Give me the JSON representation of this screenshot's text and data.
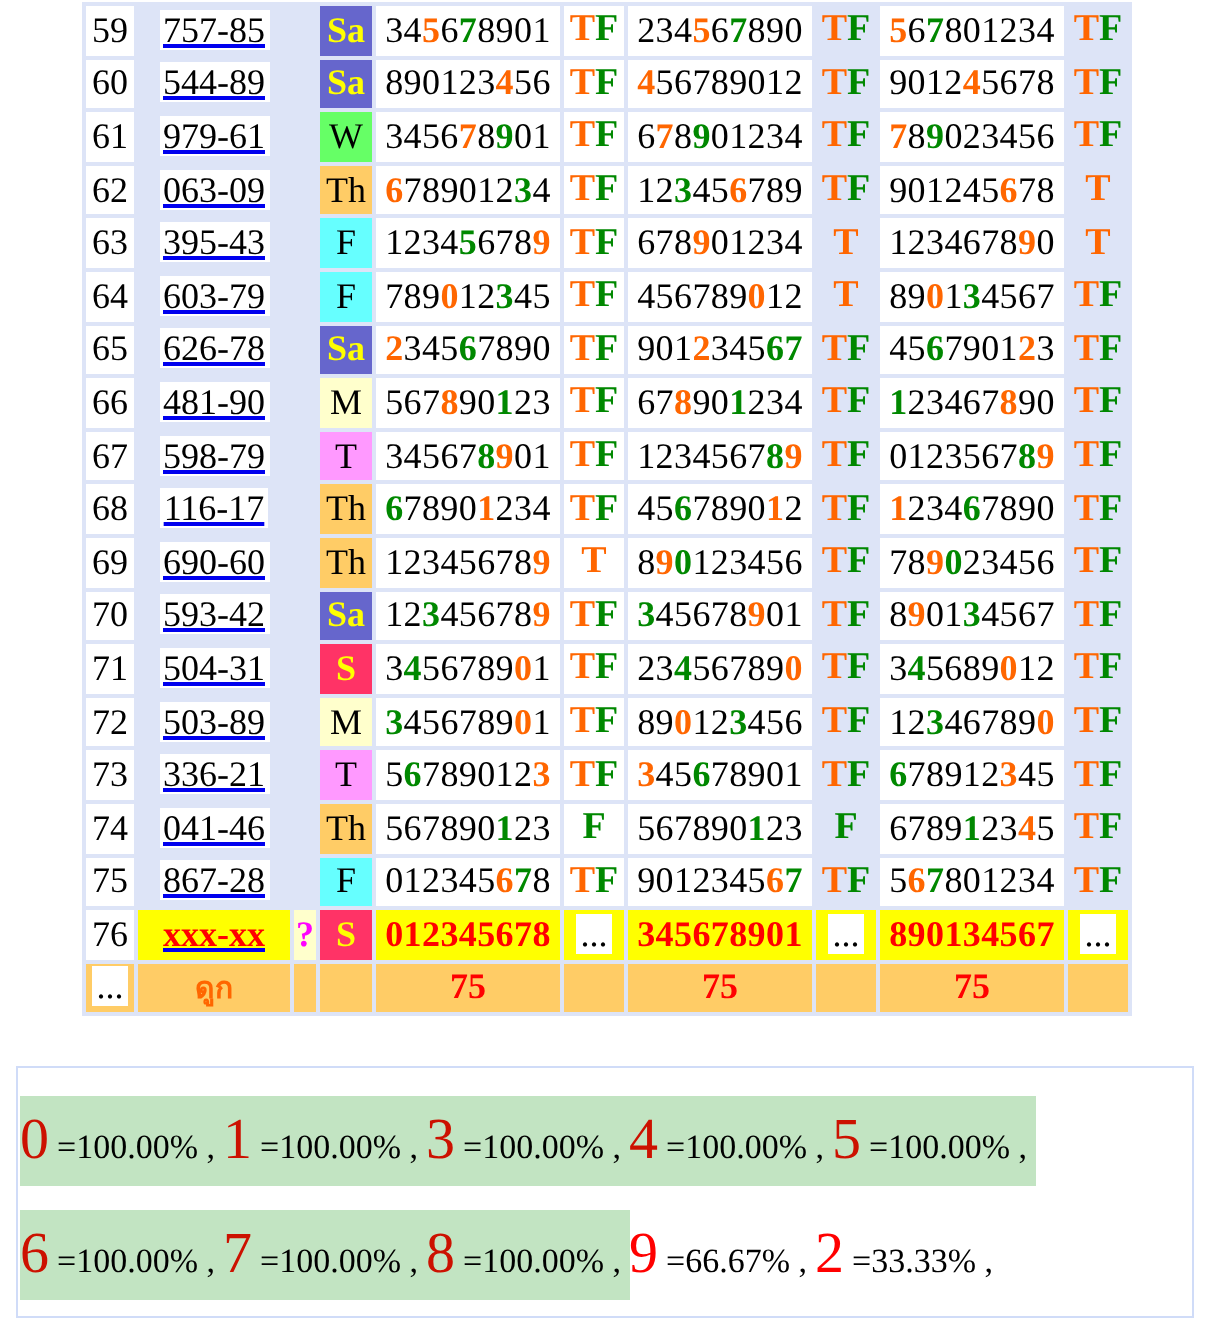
{
  "rows": [
    {
      "no": "59",
      "code": "757-85",
      "pending": false,
      "day": {
        "text": "Sa",
        "color": "#6666cc"
      },
      "sets": [
        {
          "parts": [
            {
              "text": "34",
              "kind": "plain"
            },
            {
              "text": "5",
              "kind": "hit"
            },
            {
              "text": "6",
              "kind": "plain"
            },
            {
              "text": "7",
              "kind": "near"
            },
            {
              "text": "8901",
              "kind": "plain"
            }
          ],
          "t": "T",
          "f": "F"
        },
        {
          "parts": [
            {
              "text": "234",
              "kind": "plain"
            },
            {
              "text": "5",
              "kind": "hit"
            },
            {
              "text": "6",
              "kind": "plain"
            },
            {
              "text": "7",
              "kind": "near"
            },
            {
              "text": "890",
              "kind": "plain"
            }
          ],
          "t": "T",
          "f": "F"
        },
        {
          "parts": [
            {
              "text": "5",
              "kind": "hit"
            },
            {
              "text": "6",
              "kind": "plain"
            },
            {
              "text": "7",
              "kind": "near"
            },
            {
              "text": "801234",
              "kind": "plain"
            }
          ],
          "t": "T",
          "f": "F"
        }
      ]
    },
    {
      "no": "60",
      "code": "544-89",
      "pending": false,
      "day": {
        "text": "Sa",
        "color": "#6666cc"
      },
      "sets": [
        {
          "parts": [
            {
              "text": "890123",
              "kind": "plain"
            },
            {
              "text": "4",
              "kind": "hit"
            },
            {
              "text": "56",
              "kind": "plain"
            }
          ],
          "t": "T",
          "f": "F"
        },
        {
          "parts": [
            {
              "text": "4",
              "kind": "hit"
            },
            {
              "text": "56789012",
              "kind": "plain"
            }
          ],
          "t": "T",
          "f": "F"
        },
        {
          "parts": [
            {
              "text": "9012",
              "kind": "plain"
            },
            {
              "text": "4",
              "kind": "hit"
            },
            {
              "text": "5678",
              "kind": "plain"
            }
          ],
          "t": "T",
          "f": "F"
        }
      ]
    },
    {
      "no": "61",
      "code": "979-61",
      "pending": false,
      "day": {
        "text": "W",
        "color": "#66ff66"
      },
      "sets": [
        {
          "parts": [
            {
              "text": "3456",
              "kind": "plain"
            },
            {
              "text": "7",
              "kind": "hit"
            },
            {
              "text": "8",
              "kind": "plain"
            },
            {
              "text": "9",
              "kind": "near"
            },
            {
              "text": "01",
              "kind": "plain"
            }
          ],
          "t": "T",
          "f": "F"
        },
        {
          "parts": [
            {
              "text": "6",
              "kind": "plain"
            },
            {
              "text": "7",
              "kind": "hit"
            },
            {
              "text": "8",
              "kind": "plain"
            },
            {
              "text": "9",
              "kind": "near"
            },
            {
              "text": "01234",
              "kind": "plain"
            }
          ],
          "t": "T",
          "f": "F"
        },
        {
          "parts": [
            {
              "text": "7",
              "kind": "hit"
            },
            {
              "text": "8",
              "kind": "plain"
            },
            {
              "text": "9",
              "kind": "near"
            },
            {
              "text": "023456",
              "kind": "plain"
            }
          ],
          "t": "T",
          "f": "F"
        }
      ]
    },
    {
      "no": "62",
      "code": "063-09",
      "pending": false,
      "day": {
        "text": "Th",
        "color": "#ffcc66"
      },
      "sets": [
        {
          "parts": [
            {
              "text": "6",
              "kind": "hit"
            },
            {
              "text": "789012",
              "kind": "plain"
            },
            {
              "text": "3",
              "kind": "near"
            },
            {
              "text": "4",
              "kind": "plain"
            }
          ],
          "t": "T",
          "f": "F"
        },
        {
          "parts": [
            {
              "text": "12",
              "kind": "plain"
            },
            {
              "text": "3",
              "kind": "near"
            },
            {
              "text": "45",
              "kind": "plain"
            },
            {
              "text": "6",
              "kind": "hit"
            },
            {
              "text": "789",
              "kind": "plain"
            }
          ],
          "t": "T",
          "f": "F"
        },
        {
          "parts": [
            {
              "text": "901245",
              "kind": "plain"
            },
            {
              "text": "6",
              "kind": "hit"
            },
            {
              "text": "78",
              "kind": "plain"
            }
          ],
          "t": "T"
        }
      ]
    },
    {
      "no": "63",
      "code": "395-43",
      "pending": false,
      "day": {
        "text": "F",
        "color": "#66ffff"
      },
      "sets": [
        {
          "parts": [
            {
              "text": "1234",
              "kind": "plain"
            },
            {
              "text": "5",
              "kind": "near"
            },
            {
              "text": "678",
              "kind": "plain"
            },
            {
              "text": "9",
              "kind": "hit"
            }
          ],
          "t": "T",
          "f": "F"
        },
        {
          "parts": [
            {
              "text": "678",
              "kind": "plain"
            },
            {
              "text": "9",
              "kind": "hit"
            },
            {
              "text": "01234",
              "kind": "plain"
            }
          ],
          "t": "T"
        },
        {
          "parts": [
            {
              "text": "1234678",
              "kind": "plain"
            },
            {
              "text": "9",
              "kind": "hit"
            },
            {
              "text": "0",
              "kind": "plain"
            }
          ],
          "t": "T"
        }
      ]
    },
    {
      "no": "64",
      "code": "603-79",
      "pending": false,
      "day": {
        "text": "F",
        "color": "#66ffff"
      },
      "sets": [
        {
          "parts": [
            {
              "text": "789",
              "kind": "plain"
            },
            {
              "text": "0",
              "kind": "hit"
            },
            {
              "text": "12",
              "kind": "plain"
            },
            {
              "text": "3",
              "kind": "near"
            },
            {
              "text": "45",
              "kind": "plain"
            }
          ],
          "t": "T",
          "f": "F"
        },
        {
          "parts": [
            {
              "text": "456789",
              "kind": "plain"
            },
            {
              "text": "0",
              "kind": "hit"
            },
            {
              "text": "12",
              "kind": "plain"
            }
          ],
          "t": "T"
        },
        {
          "parts": [
            {
              "text": "89",
              "kind": "plain"
            },
            {
              "text": "0",
              "kind": "hit"
            },
            {
              "text": "1",
              "kind": "plain"
            },
            {
              "text": "3",
              "kind": "near"
            },
            {
              "text": "4567",
              "kind": "plain"
            }
          ],
          "t": "T",
          "f": "F"
        }
      ]
    },
    {
      "no": "65",
      "code": "626-78",
      "pending": false,
      "day": {
        "text": "Sa",
        "color": "#6666cc"
      },
      "sets": [
        {
          "parts": [
            {
              "text": "2",
              "kind": "hit"
            },
            {
              "text": "345",
              "kind": "plain"
            },
            {
              "text": "6",
              "kind": "near"
            },
            {
              "text": "7890",
              "kind": "plain"
            }
          ],
          "t": "T",
          "f": "F"
        },
        {
          "parts": [
            {
              "text": "901",
              "kind": "plain"
            },
            {
              "text": "2",
              "kind": "hit"
            },
            {
              "text": "345",
              "kind": "plain"
            },
            {
              "text": "67",
              "kind": "near"
            }
          ],
          "t": "T",
          "f": "F"
        },
        {
          "parts": [
            {
              "text": "45",
              "kind": "plain"
            },
            {
              "text": "6",
              "kind": "near"
            },
            {
              "text": "7901",
              "kind": "plain"
            },
            {
              "text": "2",
              "kind": "hit"
            },
            {
              "text": "3",
              "kind": "plain"
            }
          ],
          "t": "T",
          "f": "F"
        }
      ]
    },
    {
      "no": "66",
      "code": "481-90",
      "pending": false,
      "day": {
        "text": "M",
        "color": "#ffffcc"
      },
      "sets": [
        {
          "parts": [
            {
              "text": "567",
              "kind": "plain"
            },
            {
              "text": "8",
              "kind": "hit"
            },
            {
              "text": "90",
              "kind": "plain"
            },
            {
              "text": "1",
              "kind": "near"
            },
            {
              "text": "23",
              "kind": "plain"
            }
          ],
          "t": "T",
          "f": "F"
        },
        {
          "parts": [
            {
              "text": "67",
              "kind": "plain"
            },
            {
              "text": "8",
              "kind": "hit"
            },
            {
              "text": "90",
              "kind": "plain"
            },
            {
              "text": "1",
              "kind": "near"
            },
            {
              "text": "234",
              "kind": "plain"
            }
          ],
          "t": "T",
          "f": "F"
        },
        {
          "parts": [
            {
              "text": "1",
              "kind": "near"
            },
            {
              "text": "23467",
              "kind": "plain"
            },
            {
              "text": "8",
              "kind": "hit"
            },
            {
              "text": "90",
              "kind": "plain"
            }
          ],
          "t": "T",
          "f": "F"
        }
      ]
    },
    {
      "no": "67",
      "code": "598-79",
      "pending": false,
      "day": {
        "text": "T",
        "color": "#ff99ff"
      },
      "sets": [
        {
          "parts": [
            {
              "text": "34567",
              "kind": "plain"
            },
            {
              "text": "8",
              "kind": "near"
            },
            {
              "text": "9",
              "kind": "hit"
            },
            {
              "text": "01",
              "kind": "plain"
            }
          ],
          "t": "T",
          "f": "F"
        },
        {
          "parts": [
            {
              "text": "1234567",
              "kind": "plain"
            },
            {
              "text": "8",
              "kind": "near"
            },
            {
              "text": "9",
              "kind": "hit"
            }
          ],
          "t": "T",
          "f": "F"
        },
        {
          "parts": [
            {
              "text": "0123567",
              "kind": "plain"
            },
            {
              "text": "8",
              "kind": "near"
            },
            {
              "text": "9",
              "kind": "hit"
            }
          ],
          "t": "T",
          "f": "F"
        }
      ]
    },
    {
      "no": "68",
      "code": "116-17",
      "pending": false,
      "day": {
        "text": "Th",
        "color": "#ffcc66"
      },
      "sets": [
        {
          "parts": [
            {
              "text": "6",
              "kind": "near"
            },
            {
              "text": "7890",
              "kind": "plain"
            },
            {
              "text": "1",
              "kind": "hit"
            },
            {
              "text": "234",
              "kind": "plain"
            }
          ],
          "t": "T",
          "f": "F"
        },
        {
          "parts": [
            {
              "text": "45",
              "kind": "plain"
            },
            {
              "text": "6",
              "kind": "near"
            },
            {
              "text": "7890",
              "kind": "plain"
            },
            {
              "text": "1",
              "kind": "hit"
            },
            {
              "text": "2",
              "kind": "plain"
            }
          ],
          "t": "T",
          "f": "F"
        },
        {
          "parts": [
            {
              "text": "1",
              "kind": "hit"
            },
            {
              "text": "234",
              "kind": "plain"
            },
            {
              "text": "6",
              "kind": "near"
            },
            {
              "text": "7890",
              "kind": "plain"
            }
          ],
          "t": "T",
          "f": "F"
        }
      ]
    },
    {
      "no": "69",
      "code": "690-60",
      "pending": false,
      "day": {
        "text": "Th",
        "color": "#ffcc66"
      },
      "sets": [
        {
          "parts": [
            {
              "text": "12345678",
              "kind": "plain"
            },
            {
              "text": "9",
              "kind": "hit"
            }
          ],
          "t": "T"
        },
        {
          "parts": [
            {
              "text": "8",
              "kind": "plain"
            },
            {
              "text": "9",
              "kind": "hit"
            },
            {
              "text": "0",
              "kind": "near"
            },
            {
              "text": "123456",
              "kind": "plain"
            }
          ],
          "t": "T",
          "f": "F"
        },
        {
          "parts": [
            {
              "text": "78",
              "kind": "plain"
            },
            {
              "text": "9",
              "kind": "hit"
            },
            {
              "text": "0",
              "kind": "near"
            },
            {
              "text": "23456",
              "kind": "plain"
            }
          ],
          "t": "T",
          "f": "F"
        }
      ]
    },
    {
      "no": "70",
      "code": "593-42",
      "pending": false,
      "day": {
        "text": "Sa",
        "color": "#6666cc"
      },
      "sets": [
        {
          "parts": [
            {
              "text": "12",
              "kind": "plain"
            },
            {
              "text": "3",
              "kind": "near"
            },
            {
              "text": "45678",
              "kind": "plain"
            },
            {
              "text": "9",
              "kind": "hit"
            }
          ],
          "t": "T",
          "f": "F"
        },
        {
          "parts": [
            {
              "text": "3",
              "kind": "near"
            },
            {
              "text": "45678",
              "kind": "plain"
            },
            {
              "text": "9",
              "kind": "hit"
            },
            {
              "text": "01",
              "kind": "plain"
            }
          ],
          "t": "T",
          "f": "F"
        },
        {
          "parts": [
            {
              "text": "8",
              "kind": "plain"
            },
            {
              "text": "9",
              "kind": "hit"
            },
            {
              "text": "01",
              "kind": "plain"
            },
            {
              "text": "3",
              "kind": "near"
            },
            {
              "text": "4567",
              "kind": "plain"
            }
          ],
          "t": "T",
          "f": "F"
        }
      ]
    },
    {
      "no": "71",
      "code": "504-31",
      "pending": false,
      "day": {
        "text": "S",
        "color": "#ff3366"
      },
      "sets": [
        {
          "parts": [
            {
              "text": "3",
              "kind": "plain"
            },
            {
              "text": "4",
              "kind": "near"
            },
            {
              "text": "56789",
              "kind": "plain"
            },
            {
              "text": "0",
              "kind": "hit"
            },
            {
              "text": "1",
              "kind": "plain"
            }
          ],
          "t": "T",
          "f": "F"
        },
        {
          "parts": [
            {
              "text": "23",
              "kind": "plain"
            },
            {
              "text": "4",
              "kind": "near"
            },
            {
              "text": "56789",
              "kind": "plain"
            },
            {
              "text": "0",
              "kind": "hit"
            }
          ],
          "t": "T",
          "f": "F"
        },
        {
          "parts": [
            {
              "text": "3",
              "kind": "plain"
            },
            {
              "text": "4",
              "kind": "near"
            },
            {
              "text": "5689",
              "kind": "plain"
            },
            {
              "text": "0",
              "kind": "hit"
            },
            {
              "text": "12",
              "kind": "plain"
            }
          ],
          "t": "T",
          "f": "F"
        }
      ]
    },
    {
      "no": "72",
      "code": "503-89",
      "pending": false,
      "day": {
        "text": "M",
        "color": "#ffffcc"
      },
      "sets": [
        {
          "parts": [
            {
              "text": "3",
              "kind": "near"
            },
            {
              "text": "456789",
              "kind": "plain"
            },
            {
              "text": "0",
              "kind": "hit"
            },
            {
              "text": "1",
              "kind": "plain"
            }
          ],
          "t": "T",
          "f": "F"
        },
        {
          "parts": [
            {
              "text": "89",
              "kind": "plain"
            },
            {
              "text": "0",
              "kind": "hit"
            },
            {
              "text": "12",
              "kind": "plain"
            },
            {
              "text": "3",
              "kind": "near"
            },
            {
              "text": "456",
              "kind": "plain"
            }
          ],
          "t": "T",
          "f": "F"
        },
        {
          "parts": [
            {
              "text": "12",
              "kind": "plain"
            },
            {
              "text": "3",
              "kind": "near"
            },
            {
              "text": "46789",
              "kind": "plain"
            },
            {
              "text": "0",
              "kind": "hit"
            }
          ],
          "t": "T",
          "f": "F"
        }
      ]
    },
    {
      "no": "73",
      "code": "336-21",
      "pending": false,
      "day": {
        "text": "T",
        "color": "#ff99ff"
      },
      "sets": [
        {
          "parts": [
            {
              "text": "5",
              "kind": "plain"
            },
            {
              "text": "6",
              "kind": "near"
            },
            {
              "text": "789012",
              "kind": "plain"
            },
            {
              "text": "3",
              "kind": "hit"
            }
          ],
          "t": "T",
          "f": "F"
        },
        {
          "parts": [
            {
              "text": "3",
              "kind": "hit"
            },
            {
              "text": "45",
              "kind": "plain"
            },
            {
              "text": "6",
              "kind": "near"
            },
            {
              "text": "78901",
              "kind": "plain"
            }
          ],
          "t": "T",
          "f": "F"
        },
        {
          "parts": [
            {
              "text": "6",
              "kind": "near"
            },
            {
              "text": "78912",
              "kind": "plain"
            },
            {
              "text": "3",
              "kind": "hit"
            },
            {
              "text": "45",
              "kind": "plain"
            }
          ],
          "t": "T",
          "f": "F"
        }
      ]
    },
    {
      "no": "74",
      "code": "041-46",
      "pending": false,
      "day": {
        "text": "Th",
        "color": "#ffcc66"
      },
      "sets": [
        {
          "parts": [
            {
              "text": "567890",
              "kind": "plain"
            },
            {
              "text": "1",
              "kind": "near"
            },
            {
              "text": "23",
              "kind": "plain"
            }
          ],
          "f": "F"
        },
        {
          "parts": [
            {
              "text": "567890",
              "kind": "plain"
            },
            {
              "text": "1",
              "kind": "near"
            },
            {
              "text": "23",
              "kind": "plain"
            }
          ],
          "f": "F"
        },
        {
          "parts": [
            {
              "text": "6789",
              "kind": "plain"
            },
            {
              "text": "1",
              "kind": "near"
            },
            {
              "text": "23",
              "kind": "plain"
            },
            {
              "text": "4",
              "kind": "hit"
            },
            {
              "text": "5",
              "kind": "plain"
            }
          ],
          "t": "T",
          "f": "F"
        }
      ]
    },
    {
      "no": "75",
      "code": "867-28",
      "pending": false,
      "day": {
        "text": "F",
        "color": "#66ffff"
      },
      "sets": [
        {
          "parts": [
            {
              "text": "012345",
              "kind": "plain"
            },
            {
              "text": "6",
              "kind": "hit"
            },
            {
              "text": "7",
              "kind": "near"
            },
            {
              "text": "8",
              "kind": "plain"
            }
          ],
          "t": "T",
          "f": "F"
        },
        {
          "parts": [
            {
              "text": "9012345",
              "kind": "plain"
            },
            {
              "text": "6",
              "kind": "hit"
            },
            {
              "text": "7",
              "kind": "near"
            }
          ],
          "t": "T",
          "f": "F"
        },
        {
          "parts": [
            {
              "text": "5",
              "kind": "plain"
            },
            {
              "text": "6",
              "kind": "hit"
            },
            {
              "text": "7",
              "kind": "near"
            },
            {
              "text": "801234",
              "kind": "plain"
            }
          ],
          "t": "T",
          "f": "F"
        }
      ]
    },
    {
      "no": "76",
      "code": "xxx-xx",
      "pending": true,
      "flag": "?",
      "day": {
        "text": "S",
        "color": "#ff3366"
      },
      "sets": [
        {
          "parts": [
            {
              "text": "012345678",
              "kind": "plain"
            }
          ],
          "more": "..."
        },
        {
          "parts": [
            {
              "text": "345678901",
              "kind": "plain"
            }
          ],
          "more": "..."
        },
        {
          "parts": [
            {
              "text": "890134567",
              "kind": "plain"
            }
          ],
          "more": "..."
        }
      ]
    }
  ],
  "footer": {
    "more": "...",
    "label": "ดูก",
    "totals": [
      "75",
      "75",
      "75"
    ]
  },
  "summary": [
    [
      {
        "digit": "0",
        "percent": "=100.00% ,",
        "full": true
      },
      {
        "digit": "1",
        "percent": "=100.00% ,",
        "full": true
      },
      {
        "digit": "3",
        "percent": "=100.00% ,",
        "full": true
      },
      {
        "digit": "4",
        "percent": "=100.00% ,",
        "full": true
      },
      {
        "digit": "5",
        "percent": "=100.00% ,",
        "full": true
      }
    ],
    [
      {
        "digit": "6",
        "percent": "=100.00% ,",
        "full": true
      },
      {
        "digit": "7",
        "percent": "=100.00% ,",
        "full": true
      },
      {
        "digit": "8",
        "percent": "=100.00% ,",
        "full": true
      },
      {
        "digit": "9",
        "percent": "=66.67% ,",
        "full": false
      },
      {
        "digit": "2",
        "percent": "=33.33% ,",
        "full": false
      }
    ]
  ]
}
